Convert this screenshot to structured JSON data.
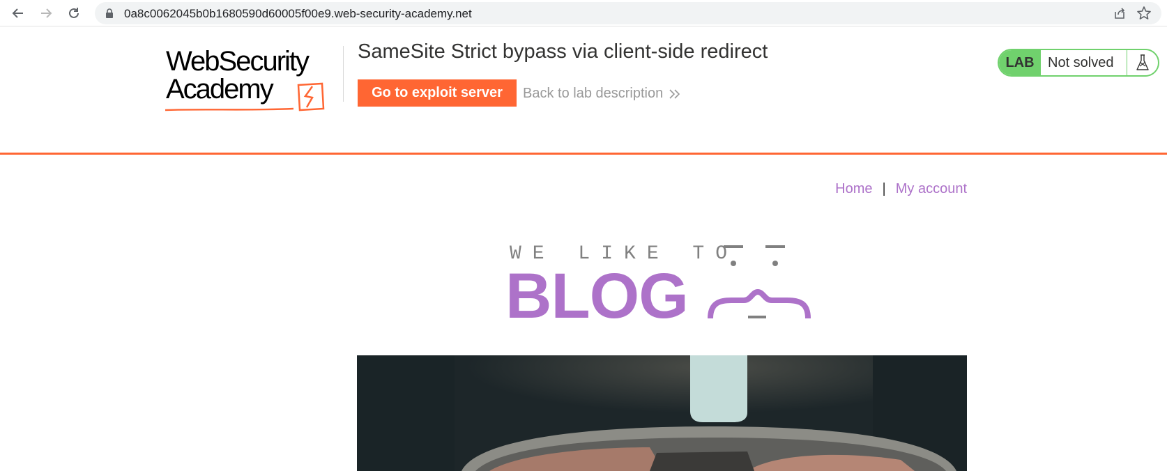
{
  "browser": {
    "url": "0a8c0062045b0b1680590d60005f00e9.web-security-academy.net"
  },
  "academy_header": {
    "logo_line1": "WebSecurity",
    "logo_line2": "Academy",
    "lab_title": "SameSite Strict bypass via client-side redirect",
    "exploit_button": "Go to exploit server",
    "back_link": "Back to lab description",
    "lab_badge": "LAB",
    "lab_state": "Not solved",
    "colors": {
      "accent": "#ff6633",
      "status_green": "#70d16d"
    }
  },
  "blog": {
    "nav": {
      "home": "Home",
      "separator": "|",
      "my_account": "My account"
    },
    "banner": {
      "small_text": "WE LIKE TO",
      "big_text": "BLOG"
    },
    "colors": {
      "link": "#ad72c9",
      "banner_grey": "#808080"
    }
  }
}
